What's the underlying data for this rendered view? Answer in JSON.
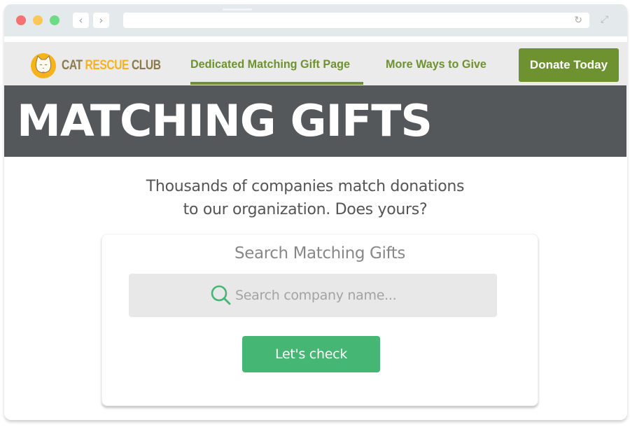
{
  "browser": {
    "window_controls": [
      "close",
      "minimize",
      "maximize"
    ],
    "back_icon": "chevron-left-icon",
    "forward_icon": "chevron-right-icon",
    "address_value": "",
    "reload_icon": "reload-icon",
    "expand_icon": "expand-icon",
    "glyphs": {
      "back": "‹",
      "forward": "›",
      "reload": "↻",
      "expand": "⤢"
    }
  },
  "header": {
    "logo": {
      "icon": "cat-face-icon",
      "word1": "CAT",
      "word2": "RESCUE",
      "word3": "CLUB"
    },
    "nav": [
      {
        "label": "Dedicated Matching Gift Page",
        "active": true
      },
      {
        "label": "More Ways to Give",
        "active": false
      }
    ],
    "donate_label": "Donate Today"
  },
  "hero": {
    "title": "MATCHING GIFTS"
  },
  "tagline": {
    "line1": "Thousands of companies match donations",
    "line2": "to our organization. Does yours?"
  },
  "search_card": {
    "title": "Search Matching Gifts",
    "search_placeholder": "Search company name...",
    "search_value": "",
    "button_label": "Let's check"
  },
  "colors": {
    "brand_green": "#6f9230",
    "hero_bg": "#54585b",
    "action_green": "#45b673",
    "logo_gold": "#f7b21c",
    "logo_brown": "#8b7a4c"
  }
}
